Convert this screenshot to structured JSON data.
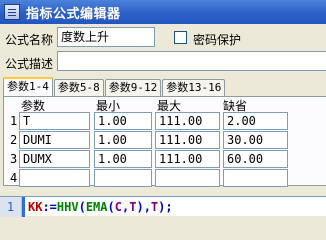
{
  "window": {
    "title": "指标公式编辑器"
  },
  "form": {
    "name_label": "公式名称",
    "name_value": "度数上升",
    "password_label": "密码保护",
    "description_label": "公式描述",
    "description_value": ""
  },
  "tabs": [
    {
      "label": "参数1-4",
      "active": true
    },
    {
      "label": "参数5-8",
      "active": false
    },
    {
      "label": "参数9-12",
      "active": false
    },
    {
      "label": "参数13-16",
      "active": false
    }
  ],
  "params": {
    "headers": {
      "name": "参数",
      "min": "最小",
      "max": "最大",
      "default": "缺省"
    },
    "rows": [
      {
        "num": "1",
        "name": "T",
        "min": "1.00",
        "max": "111.00",
        "default": "2.00"
      },
      {
        "num": "2",
        "name": "DUMI",
        "min": "1.00",
        "max": "111.00",
        "default": "30.00"
      },
      {
        "num": "3",
        "name": "DUMX",
        "min": "1.00",
        "max": "111.00",
        "default": "60.00"
      },
      {
        "num": "4",
        "name": "",
        "min": "",
        "max": "",
        "default": ""
      }
    ]
  },
  "editor": {
    "line_number": "1",
    "code_parts": [
      "KK",
      ":=",
      "HHV",
      "(",
      "EMA",
      "(",
      "C",
      ",",
      "T",
      ")",
      ",",
      "T",
      ");"
    ]
  }
}
